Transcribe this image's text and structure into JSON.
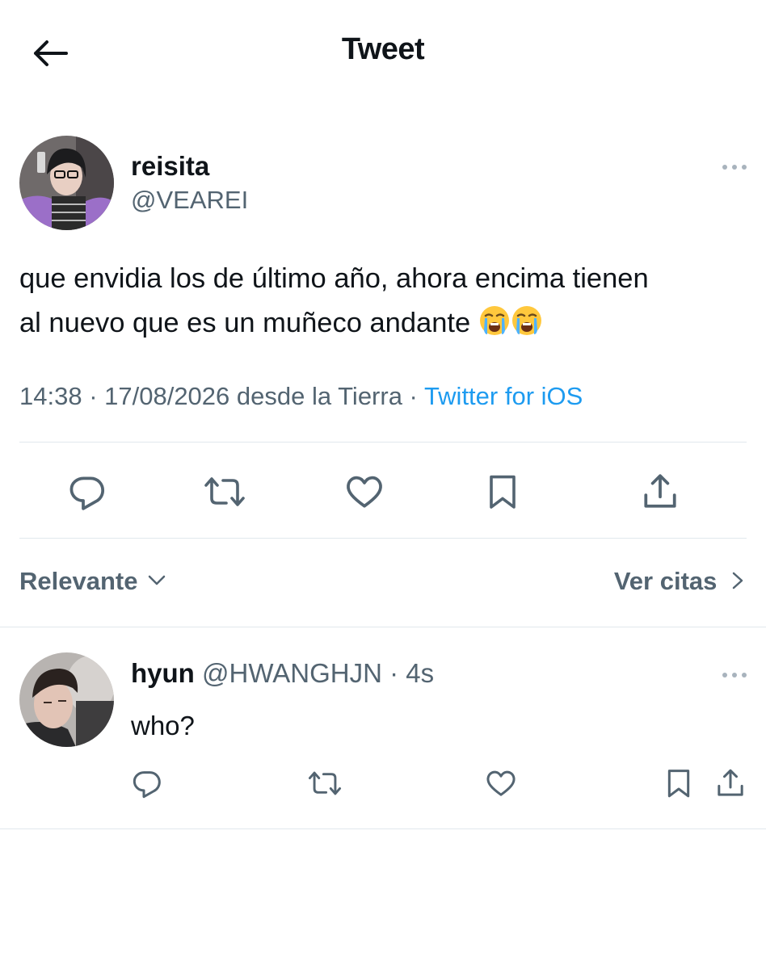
{
  "header": {
    "title": "Tweet",
    "back_icon": "arrow-left-icon"
  },
  "tweet": {
    "author": {
      "name": "reisita",
      "handle": "@VEAREI",
      "avatar": "avatar-photo-reisita"
    },
    "text_line1": "que envidia los de último año, ahora encima tienen",
    "text_line2": "al nuevo que es un muñeco andante",
    "emojis": [
      "loudly-crying-face",
      "loudly-crying-face"
    ],
    "meta_time": "14:38 · 17/08/2026 desde la Tierra · ",
    "meta_source": "Twitter for iOS",
    "actions": [
      "reply-icon",
      "retweet-icon",
      "like-icon",
      "bookmark-icon",
      "share-icon"
    ]
  },
  "filters": {
    "sort_label": "Relevante",
    "quotes_label": "Ver citas"
  },
  "reply": {
    "name": "hyun",
    "handle": "@HWANGHJN",
    "time": " · 4s",
    "text": "who?",
    "avatar": "avatar-photo-hyun",
    "actions": [
      "reply-icon",
      "retweet-icon",
      "like-icon",
      "bookmark-icon",
      "share-icon"
    ]
  },
  "colors": {
    "text": "#0f1419",
    "muted": "#536471",
    "accent": "#1d9bf0",
    "divider": "#e1e8ed"
  }
}
